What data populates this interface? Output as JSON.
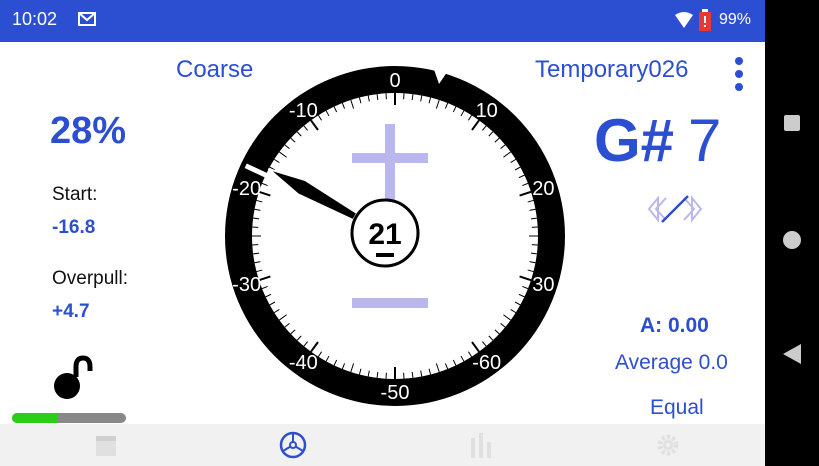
{
  "status": {
    "time": "10:02",
    "battery": "99%",
    "icons": [
      "mail-icon",
      "wifi-icon",
      "battery-icon"
    ]
  },
  "header": {
    "mode": "Coarse",
    "temperament_name": "Temporary026"
  },
  "left": {
    "percent": "28%",
    "start_label": "Start:",
    "start_value": "-16.8",
    "overpull_label": "Overpull:",
    "overpull_value": "+4.7",
    "progress_fraction": 0.4
  },
  "dial": {
    "labels": [
      "0",
      "10",
      "20",
      "30",
      "-60",
      "-50",
      "-40",
      "-30",
      "-20",
      "-10"
    ],
    "center_value": "21",
    "needle_cents": -17
  },
  "right": {
    "note_name": "G#",
    "octave": "7",
    "a_offset": "A: 0.00",
    "average": "Average 0.0",
    "temperament": "Equal"
  },
  "colors": {
    "accent": "#2c4fd1",
    "status_bar": "#2c4fd1",
    "progress_fill": "#2ecc1a",
    "symbol_tint": "#b9b7ee"
  },
  "tabs": [
    {
      "name": "tab-calendar",
      "icon": "calendar-icon",
      "active": false
    },
    {
      "name": "tab-tuner",
      "icon": "steering-wheel-icon",
      "active": true
    },
    {
      "name": "tab-bars",
      "icon": "bar-chart-icon",
      "active": false
    },
    {
      "name": "tab-settings",
      "icon": "gear-icon",
      "active": false
    }
  ]
}
